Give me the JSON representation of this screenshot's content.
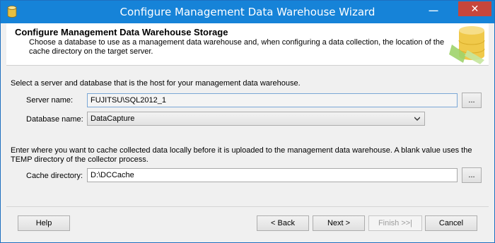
{
  "window": {
    "title": "Configure Management Data Warehouse Wizard",
    "minimize_glyph": "—",
    "close_glyph": "✕"
  },
  "header": {
    "title": "Configure Management Data Warehouse Storage",
    "description": "Choose a database to use as a management data warehouse and, when configuring a data collection, the location of the cache directory on the target server."
  },
  "server_section": {
    "intro": "Select a server and database that is the host for your management data warehouse.",
    "server_label": "Server name:",
    "server_value": "FUJITSU\\SQL2012_1",
    "server_browse": "...",
    "database_label": "Database name:",
    "database_value": "DataCapture"
  },
  "cache_section": {
    "intro": "Enter where you want to cache collected data locally before it is uploaded to the management data warehouse. A blank value uses the TEMP directory of the collector process.",
    "cache_label": "Cache directory:",
    "cache_value": "D:\\DCCache",
    "cache_browse": "..."
  },
  "footer": {
    "help": "Help",
    "back": "< Back",
    "next": "Next >",
    "finish": "Finish >>|",
    "cancel": "Cancel"
  },
  "colors": {
    "titlebar": "#1683d8",
    "close": "#c7463b"
  },
  "icons": [
    "database-icon",
    "minimize-icon",
    "close-icon",
    "dropdown-arrow-icon",
    "database-cylinder-art"
  ]
}
